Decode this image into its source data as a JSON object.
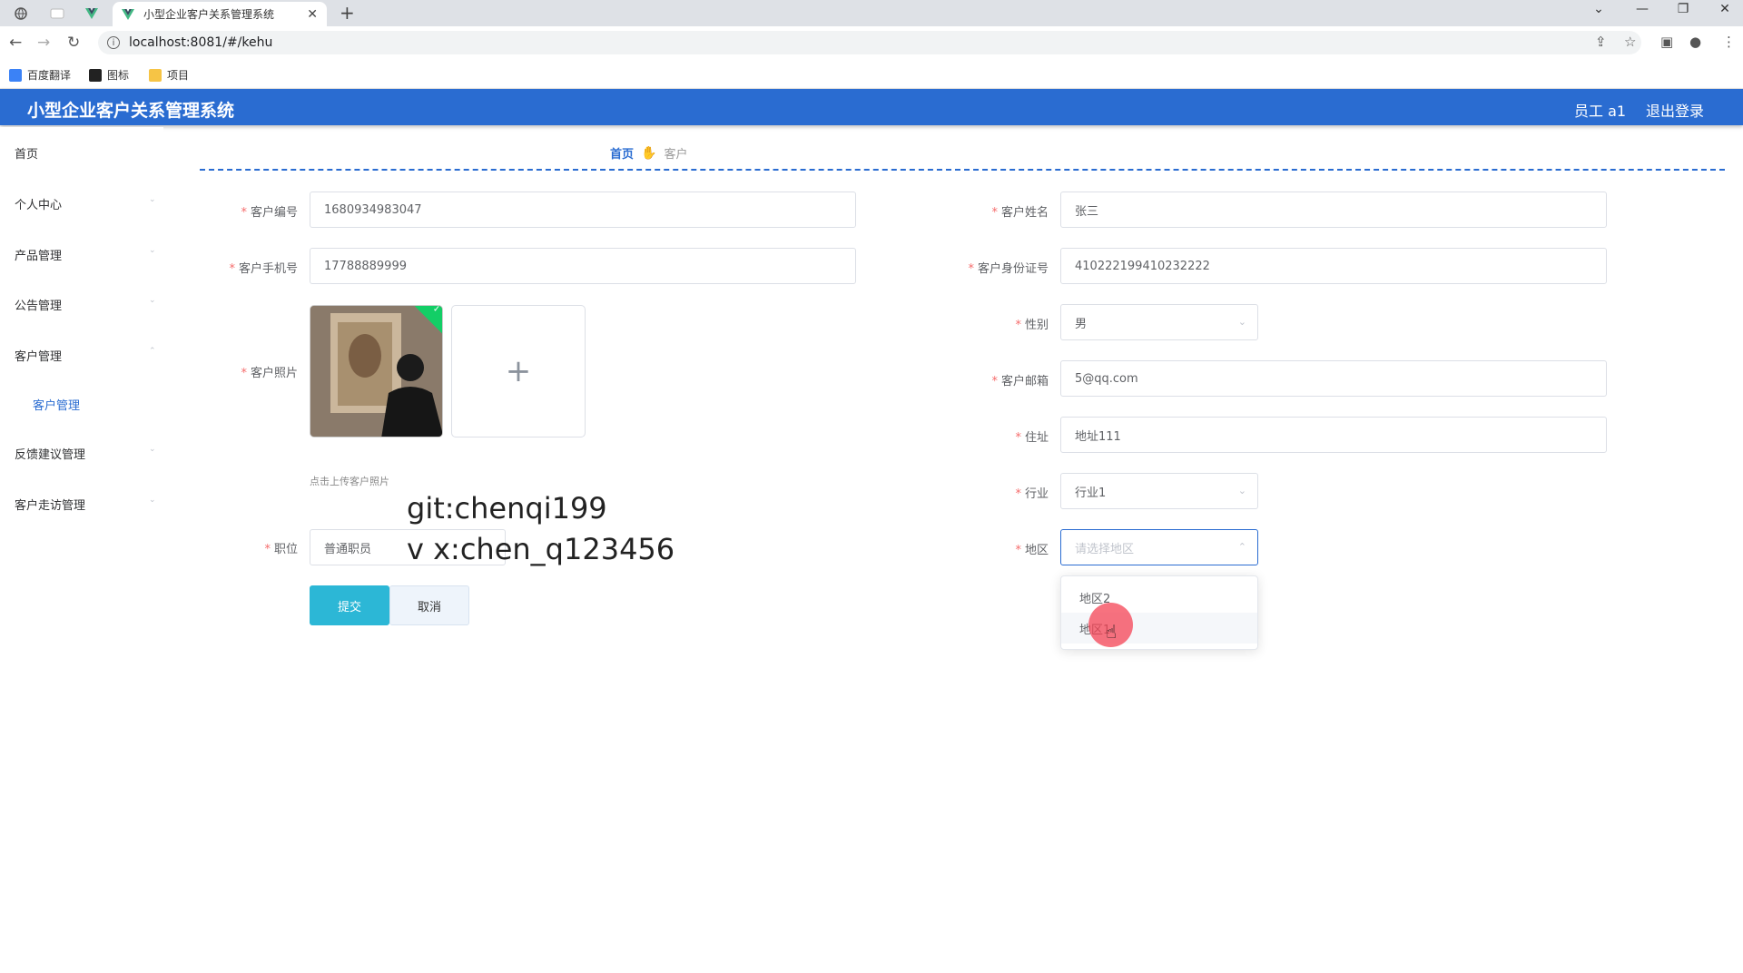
{
  "browser": {
    "active_tab_title": "小型企业客户关系管理系统",
    "url": "localhost:8081/#/kehu",
    "bookmarks": [
      "百度翻译",
      "图标",
      "项目"
    ],
    "new_tab_label": "+",
    "tab_close": "✕"
  },
  "header": {
    "title": "小型企业客户关系管理系统",
    "user": "员工 a1",
    "logout": "退出登录",
    "brand_color": "#2a6cd1"
  },
  "sidebar": {
    "items": [
      {
        "label": "首页"
      },
      {
        "label": "个人中心"
      },
      {
        "label": "产品管理"
      },
      {
        "label": "公告管理"
      },
      {
        "label": "客户管理"
      },
      {
        "label": "客户管理"
      },
      {
        "label": "反馈建议管理"
      },
      {
        "label": "客户走访管理"
      }
    ]
  },
  "breadcrumb": {
    "home": "首页",
    "separator_icon": "hand-icon",
    "current": "客户"
  },
  "form": {
    "customer_no": {
      "label": "客户编号",
      "value": "1680934983047"
    },
    "customer_name": {
      "label": "客户姓名",
      "value": "张三"
    },
    "phone": {
      "label": "客户手机号",
      "value": "17788889999"
    },
    "id_card": {
      "label": "客户身份证号",
      "value": "410222199410232222"
    },
    "photo": {
      "label": "客户照片",
      "tip": "点击上传客户照片",
      "add_symbol": "+"
    },
    "gender": {
      "label": "性别",
      "value": "男"
    },
    "email": {
      "label": "客户邮箱",
      "value": "5@qq.com"
    },
    "address": {
      "label": "住址",
      "value": "地址111"
    },
    "industry": {
      "label": "行业",
      "value": "行业1"
    },
    "region": {
      "label": "地区",
      "placeholder": "请选择地区",
      "options": [
        "地区2",
        "地区1"
      ],
      "hovered_index": 1
    },
    "position": {
      "label": "职位",
      "value": "普通职员"
    },
    "submit": "提交",
    "cancel": "取消"
  },
  "watermark": {
    "line1": "git:chenqi199",
    "line2": "v x:chen_q123456"
  }
}
